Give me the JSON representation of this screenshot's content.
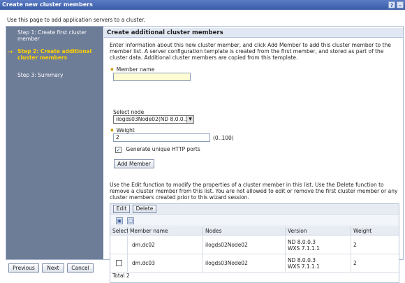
{
  "window": {
    "title": "Create new cluster members",
    "help_icon": "?",
    "close_icon": "–"
  },
  "intro": "Use this page to add application servers to a cluster.",
  "steps": [
    {
      "label": "Step 1: Create first cluster member"
    },
    {
      "label": "Step 2: Create additional cluster members"
    },
    {
      "label": "Step 3: Summary"
    }
  ],
  "main": {
    "heading": "Create additional cluster members",
    "description": "Enter information about this new cluster member, and click Add Member to add this cluster member to the member list. A server configuration template is created from the first member, and stored as part of the cluster data. Additional cluster members are copied from this template.",
    "member_name_label": "Member name",
    "member_name_value": "",
    "select_node_label": "Select node",
    "select_node_value": "ilogds03Node02(ND 8.0.0.3)",
    "weight_label": "Weight",
    "weight_value": "2",
    "weight_range": "(0..100)",
    "generate_ports_label": "Generate unique HTTP ports",
    "generate_ports_checked": true,
    "add_member_button": "Add Member",
    "list_description": "Use the Edit function to modify the properties of a cluster member in this list. Use the Delete function to remove a cluster member from this list. You are not allowed to edit or remove the first cluster member or any cluster members created prior to this wizard session."
  },
  "table": {
    "edit_button": "Edit",
    "delete_button": "Delete",
    "headers": [
      "Select",
      "Member name",
      "Nodes",
      "Version",
      "Weight"
    ],
    "rows": [
      {
        "member": "dm.dc02",
        "node": "ilogds02Node02",
        "version1": "ND 8.0.0.3",
        "version2": "WXS 7.1.1.1",
        "weight": "2"
      },
      {
        "member": "dm.dc03",
        "node": "ilogds03Node02",
        "version1": "ND 8.0.0.3",
        "version2": "WXS 7.1.1.1",
        "weight": "2"
      }
    ],
    "total": "Total 2"
  },
  "footer": {
    "previous": "Previous",
    "next": "Next",
    "cancel": "Cancel"
  }
}
